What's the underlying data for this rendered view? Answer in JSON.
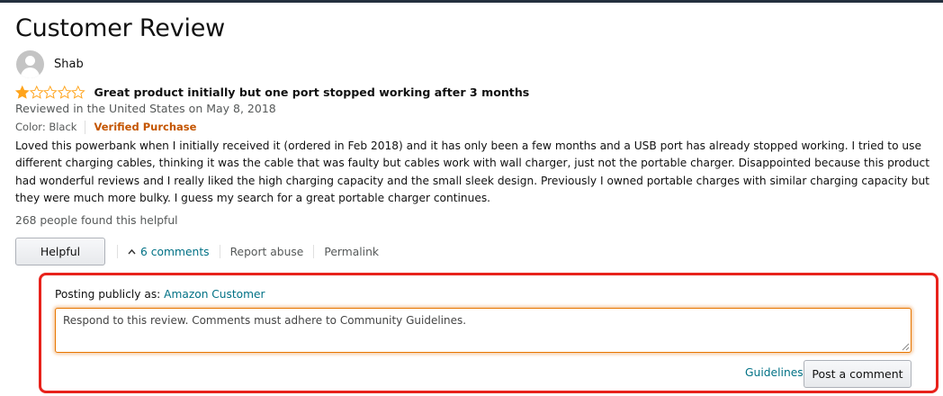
{
  "page": {
    "title": "Customer Review"
  },
  "reviewer": {
    "name": "Shab",
    "avatar_icon": "user-avatar-icon"
  },
  "review": {
    "rating": 1,
    "max_rating": 5,
    "star_color": "#ffa41c",
    "title": "Great product initially but one port stopped working after 3 months",
    "date_text": "Reviewed in the United States on May 8, 2018",
    "color_label": "Color: Black",
    "verified_label": "Verified Purchase",
    "body": "Loved this powerbank when I initially received it (ordered in Feb 2018) and it has only been a few months and a USB port has already stopped working. I tried to use different charging cables, thinking it was the cable that was faulty but cables work with wall charger, just not the portable charger. Disappointed because this product had wonderful reviews and I really liked the high charging capacity and the small sleek design. Previously I owned portable charges with similar charging capacity but they were much more bulky. I guess my search for a great portable charger continues.",
    "helpful_count_text": "268 people found this helpful"
  },
  "actions": {
    "helpful_label": "Helpful",
    "comments_label": "6 comments",
    "report_label": "Report abuse",
    "permalink_label": "Permalink"
  },
  "comment_form": {
    "posting_prefix": "Posting publicly as:",
    "posting_name": "Amazon Customer",
    "placeholder": "Respond to this review. Comments must adhere to Community Guidelines.",
    "value": "",
    "guidelines_label": "Guidelines",
    "post_label": "Post a comment",
    "highlight_color": "#e8221b"
  }
}
